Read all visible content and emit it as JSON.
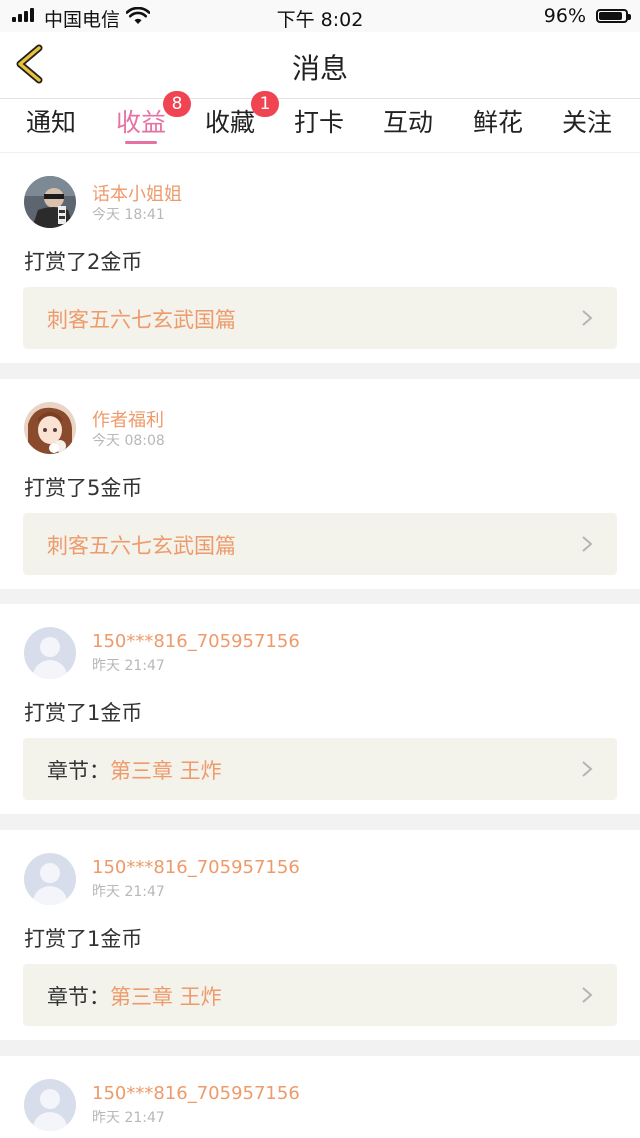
{
  "status_bar": {
    "carrier": "中国电信",
    "time": "下午 8:02",
    "battery_percent": "96%",
    "battery_level": 0.96
  },
  "header": {
    "title": "消息"
  },
  "tabs": [
    {
      "label": "通知",
      "active": false,
      "badge": ""
    },
    {
      "label": "收益",
      "active": true,
      "badge": "8"
    },
    {
      "label": "收藏",
      "active": false,
      "badge": "1"
    },
    {
      "label": "打卡",
      "active": false,
      "badge": ""
    },
    {
      "label": "互动",
      "active": false,
      "badge": ""
    },
    {
      "label": "鲜花",
      "active": false,
      "badge": ""
    },
    {
      "label": "关注",
      "active": false,
      "badge": ""
    }
  ],
  "notifications": [
    {
      "user": "话本小姐姐",
      "time": "今天 18:41",
      "reward": "打赏了2金币",
      "link_label": "",
      "link_text": "刺客五六七玄武国篇",
      "avatar": "photo-avatar-dark"
    },
    {
      "user": "作者福利",
      "time": "今天 08:08",
      "reward": "打赏了5金币",
      "link_label": "",
      "link_text": "刺客五六七玄武国篇",
      "avatar": "anime-girl-avatar"
    },
    {
      "user": "150***816_705957156",
      "time": "昨天 21:47",
      "reward": "打赏了1金币",
      "link_label": "章节：",
      "link_text": "第三章 王炸",
      "avatar": "default-user-avatar"
    },
    {
      "user": "150***816_705957156",
      "time": "昨天 21:47",
      "reward": "打赏了1金币",
      "link_label": "章节：",
      "link_text": "第三章 王炸",
      "avatar": "default-user-avatar"
    },
    {
      "user": "150***816_705957156",
      "time": "昨天 21:47",
      "reward": "",
      "link_label": "",
      "link_text": "",
      "avatar": "default-user-avatar"
    }
  ],
  "colors": {
    "accent_pink": "#e672a3",
    "name_orange": "#ee9a6a",
    "badge_red": "#f04452",
    "back_icon_yellow": "#e8c23a"
  }
}
